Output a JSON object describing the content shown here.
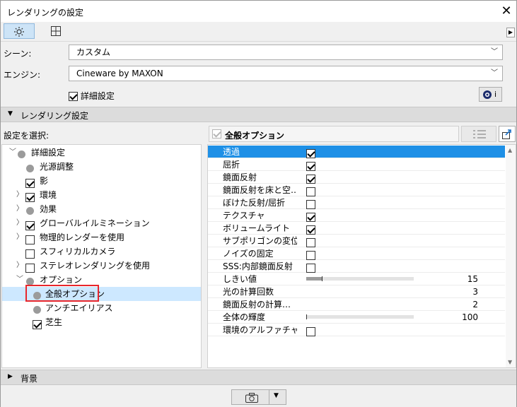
{
  "window": {
    "title": "レンダリングの設定"
  },
  "toolbar": {
    "settings_icon": "gear-icon",
    "layout_icon": "grid-icon"
  },
  "scene": {
    "label": "シーン:",
    "value": "カスタム"
  },
  "engine": {
    "label": "エンジン:",
    "value": "Cineware by MAXON"
  },
  "detailed": {
    "label": "詳細設定",
    "checked": true
  },
  "info_button": {
    "label": "i"
  },
  "rendering_section": {
    "title": "レンダリング設定"
  },
  "left": {
    "select_label": "設定を選択:"
  },
  "tree": [
    {
      "label": "詳細設定",
      "icon": "dot",
      "expander": "open"
    },
    {
      "label": "光源調整",
      "icon": "dot",
      "expander": ""
    },
    {
      "label": "影",
      "icon": "checked",
      "expander": ""
    },
    {
      "label": "環境",
      "icon": "checked",
      "expander": "closed"
    },
    {
      "label": "効果",
      "icon": "dot",
      "expander": "closed"
    },
    {
      "label": "グローバルイルミネーション",
      "icon": "checked",
      "expander": "closed"
    },
    {
      "label": "物理的レンダーを使用",
      "icon": "unchecked",
      "expander": "closed"
    },
    {
      "label": "スフィリカルカメラ",
      "icon": "unchecked",
      "expander": ""
    },
    {
      "label": "ステレオレンダリングを使用",
      "icon": "unchecked",
      "expander": "closed"
    },
    {
      "label": "オプション",
      "icon": "dot",
      "expander": "open"
    },
    {
      "label": "全般オプション",
      "icon": "dot",
      "expander": "",
      "selected": true
    },
    {
      "label": "アンチエイリアス",
      "icon": "dot",
      "expander": ""
    },
    {
      "label": "芝生",
      "icon": "checked",
      "expander": ""
    }
  ],
  "right": {
    "header_label": "全般オプション",
    "header_checked": true
  },
  "properties": [
    {
      "name": "透過",
      "type": "checkbox",
      "checked": true
    },
    {
      "name": "屈折",
      "type": "checkbox",
      "checked": true
    },
    {
      "name": "鏡面反射",
      "type": "checkbox",
      "checked": true
    },
    {
      "name": "鏡面反射を床と空…",
      "type": "checkbox",
      "checked": false
    },
    {
      "name": "ぼけた反射/屈折",
      "type": "checkbox",
      "checked": false
    },
    {
      "name": "テクスチャ",
      "type": "checkbox",
      "checked": true
    },
    {
      "name": "ボリュームライト",
      "type": "checkbox",
      "checked": true
    },
    {
      "name": "サブポリゴンの変位",
      "type": "checkbox",
      "checked": false
    },
    {
      "name": "ノイズの固定",
      "type": "checkbox",
      "checked": false
    },
    {
      "name": "SSS:内部鏡面反射",
      "type": "checkbox",
      "checked": false
    },
    {
      "name": "しきい値",
      "type": "slider",
      "value": "15",
      "level": 0.15
    },
    {
      "name": "光の計算回数",
      "type": "number",
      "value": "3"
    },
    {
      "name": "鏡面反射の計算…",
      "type": "number",
      "value": "2"
    },
    {
      "name": "全体の輝度",
      "type": "slider",
      "value": "100",
      "level": 0.0
    },
    {
      "name": "環境のアルファチャ…",
      "type": "checkbox",
      "checked": false
    }
  ],
  "background_section": {
    "title": "背景"
  },
  "bottom": {
    "camera_icon": "camera-icon"
  },
  "colors": {
    "selected_row": "#1e90e6",
    "selected_tree": "#cde8ff",
    "highlight_box": "#e8262c"
  }
}
